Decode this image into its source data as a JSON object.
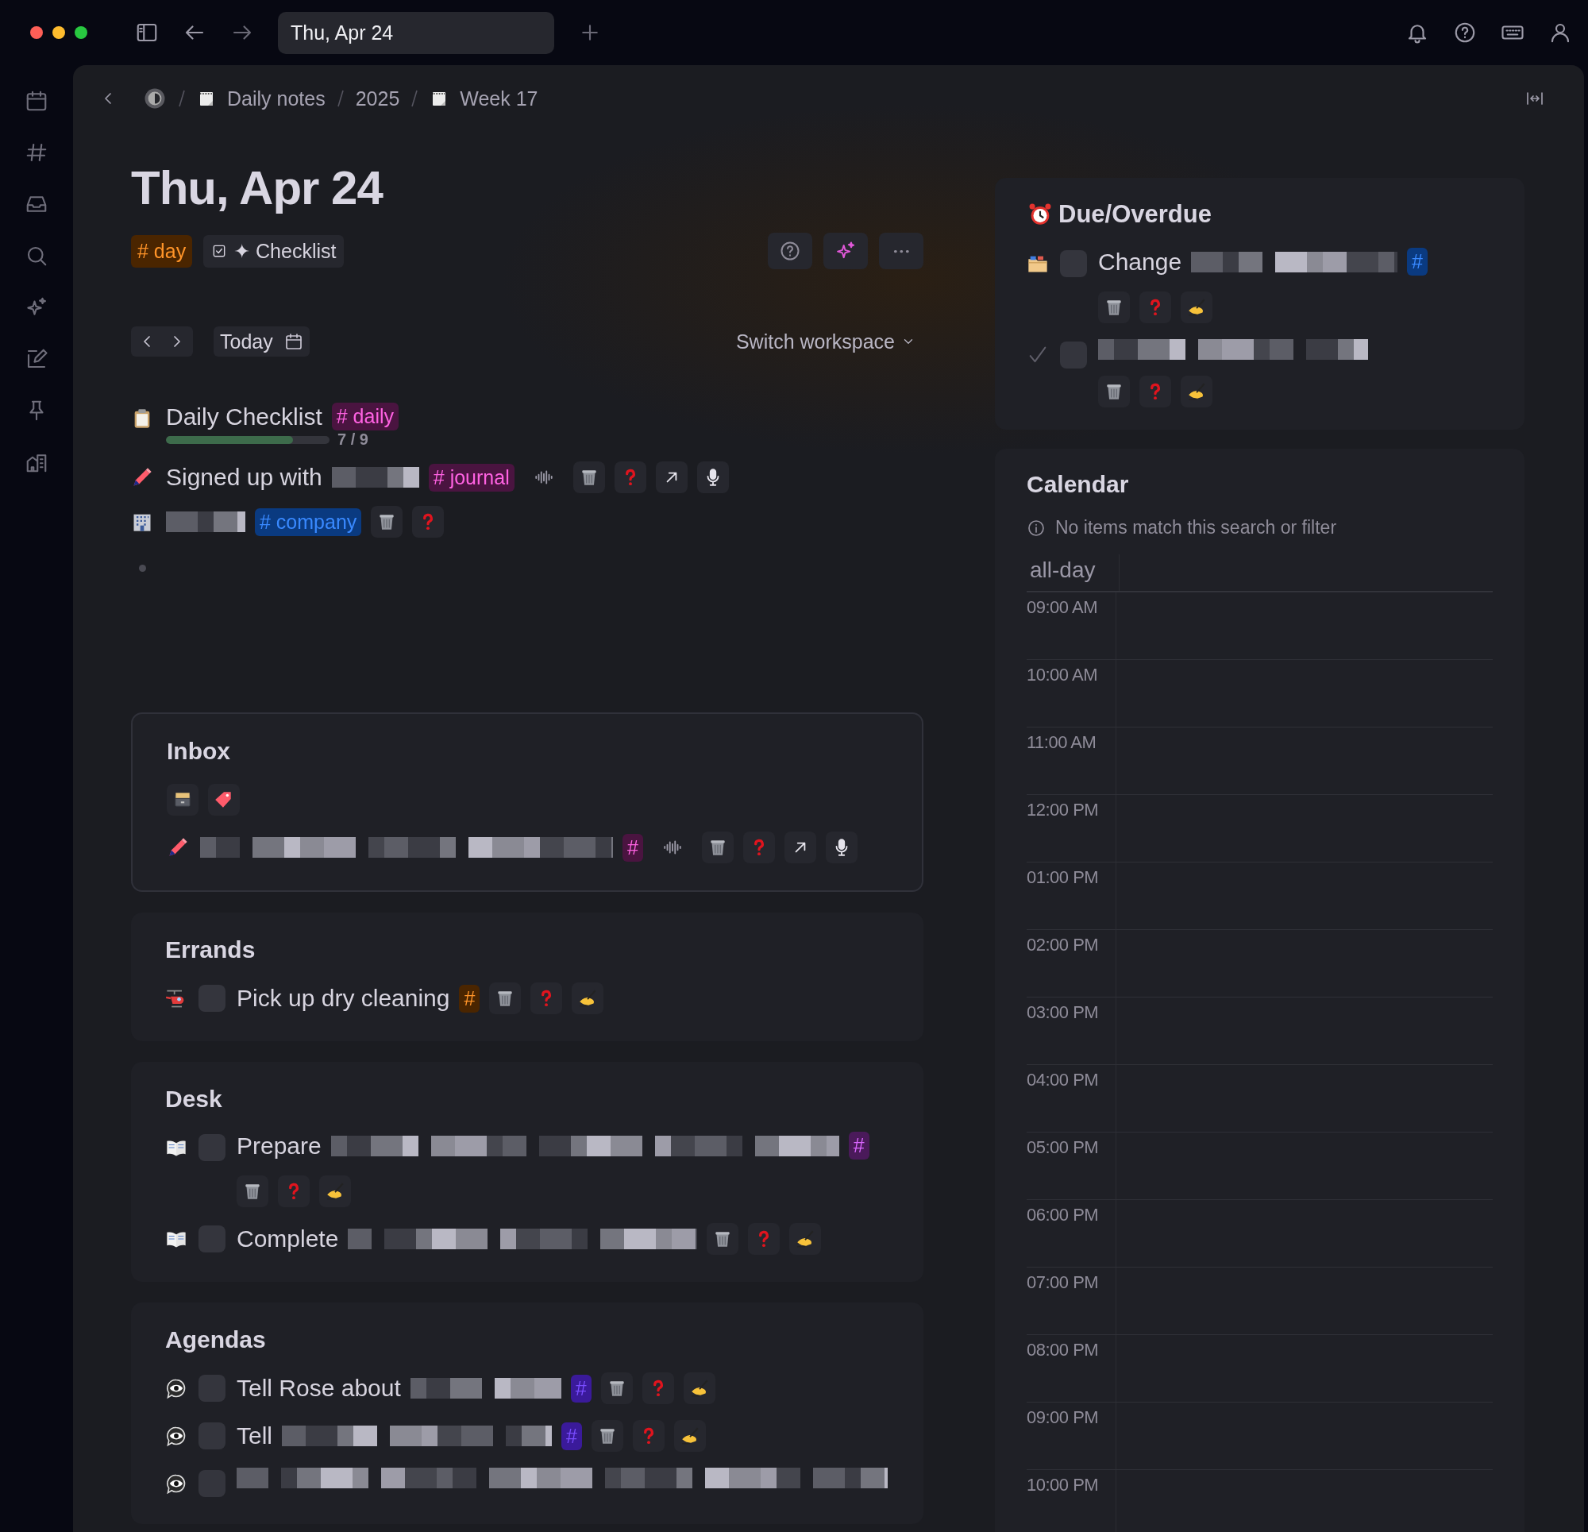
{
  "window": {
    "tab_title": "Thu, Apr 24"
  },
  "breadcrumb": [
    "Daily notes",
    "2025",
    "Week 17"
  ],
  "page": {
    "title": "Thu, Apr 24",
    "tags": [
      {
        "label": "# day",
        "color": "#4a2500"
      }
    ],
    "template_button": "✦ Checklist"
  },
  "nav": {
    "today": "Today",
    "workspace": "Switch workspace"
  },
  "checklist": {
    "title": "Daily Checklist",
    "tag": {
      "label": "# daily",
      "color": "#4a1440"
    },
    "level": 0.778,
    "reading": "7 / 9"
  },
  "entries": [
    {
      "kind": "note",
      "text": "Signed up with",
      "obscured": true,
      "tag": {
        "label": "# journal",
        "color": "#4a1440"
      }
    },
    {
      "kind": "reference",
      "obscured": true,
      "tag": {
        "label": "# company",
        "color": "#0a3a80"
      }
    }
  ],
  "sections": [
    {
      "title": "Inbox",
      "kind": "inbox",
      "items": [
        {
          "kind": "note",
          "obscured": true,
          "tag": {
            "label": "#",
            "color": "#4a1440"
          }
        }
      ]
    },
    {
      "title": "Errands",
      "kind": "plain",
      "items": [
        {
          "kind": "task",
          "checked": false,
          "text": "Pick up dry cleaning",
          "obscured": false,
          "tag": {
            "label": "#",
            "color": "#4a2500"
          }
        }
      ]
    },
    {
      "title": "Desk",
      "kind": "plain",
      "items": [
        {
          "kind": "task",
          "checked": false,
          "text": "Prepare",
          "obscured": true,
          "tag": {
            "label": "#",
            "color": "#4a1a5a"
          }
        },
        {
          "kind": "task",
          "checked": false,
          "text": "Complete",
          "obscured": true
        }
      ]
    },
    {
      "title": "Agendas",
      "kind": "plain",
      "items": [
        {
          "kind": "task",
          "checked": false,
          "text": "Tell Rose about",
          "obscured": true,
          "tag": {
            "label": "#",
            "color": "#3a1a9a"
          }
        },
        {
          "kind": "task",
          "checked": false,
          "text": "Tell",
          "obscured": true,
          "tag": {
            "label": "#",
            "color": "#3a1a9a"
          }
        },
        {
          "kind": "stub",
          "checked": false,
          "obscured": true
        }
      ]
    }
  ],
  "due": {
    "title": "Due/Overdue",
    "items": [
      {
        "kind": "open",
        "checked": false,
        "text": "Change",
        "obscured": true,
        "tag": {
          "label": "#",
          "color": "#0a3a80"
        }
      },
      {
        "kind": "done",
        "checked": false,
        "obscured": true
      }
    ]
  },
  "calendar": {
    "title": "Calendar",
    "message": "No items match this search or filter",
    "all_day": "all-day",
    "times": [
      "09:00 AM",
      "10:00 AM",
      "11:00 AM",
      "12:00 PM",
      "01:00 PM",
      "02:00 PM",
      "03:00 PM",
      "04:00 PM",
      "05:00 PM",
      "06:00 PM",
      "07:00 PM",
      "08:00 PM",
      "09:00 PM",
      "10:00 PM"
    ]
  }
}
